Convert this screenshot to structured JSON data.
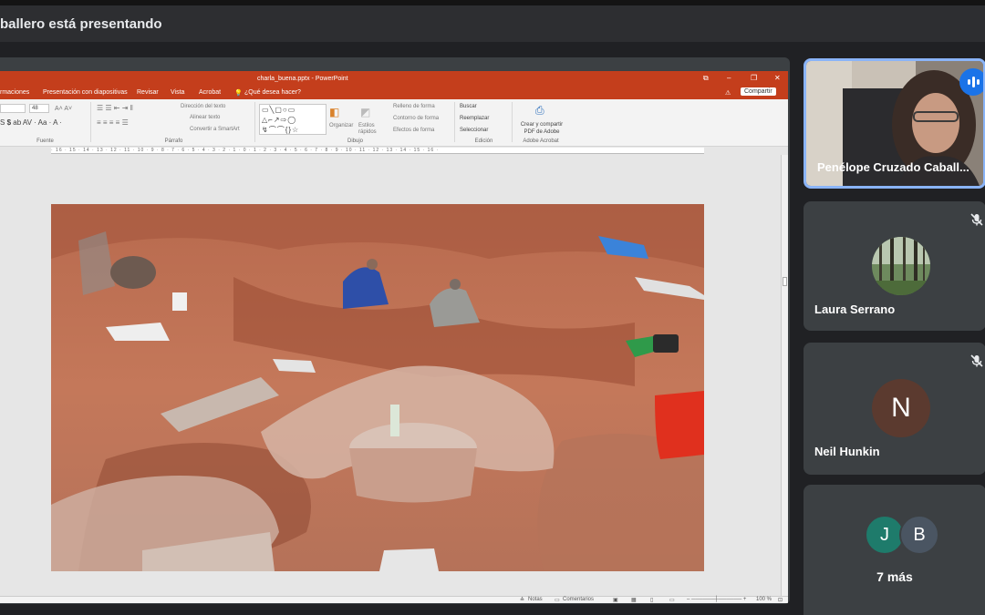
{
  "meet": {
    "presenting_banner": "ballero está presentando"
  },
  "powerpoint": {
    "window_title": "charla_buena.pptx - PowerPoint",
    "window_controls": [
      "⧉",
      "–",
      "❐",
      "✕"
    ],
    "menu": {
      "items": [
        "rmaciones",
        "Presentación con diapositivas",
        "Revisar",
        "Vista",
        "Acrobat"
      ],
      "tell_me": "¿Qué desea hacer?",
      "share": "Compartir"
    },
    "ribbon": {
      "font_size": "48",
      "groups": {
        "font": "Fuente",
        "paragraph": "Párrafo",
        "drawing": "Dibujo",
        "editing": "Edición",
        "acrobat": "Adobe Acrobat"
      },
      "paragraph_items": [
        "Dirección del texto",
        "Alinear texto",
        "Convertir a SmartArt"
      ],
      "drawing_items": {
        "organize": "Organizar",
        "quick_styles": "Estilos rápidos",
        "shape_fill": "Relleno de forma",
        "shape_outline": "Contorno de forma",
        "shape_effects": "Efectos de forma"
      },
      "editing_items": [
        "Buscar",
        "Reemplazar",
        "Seleccionar"
      ],
      "acrobat_button": "Crear y compartir PDF de Adobe"
    },
    "ruler_text": "· 16 · 15 · 14 · 13 · 12 · 11 · 10 · 9 · 8 · 7 · 6 · 5 · 4 · 3 · 2 · 1 · 0 · 1 · 2 · 3 · 4 · 5 · 6 · 7 · 8 · 9 · 10 · 11 · 12 · 13 · 14 · 15 · 16 ·",
    "status": {
      "notes": "Notas",
      "comments": "Comentarios",
      "zoom": "100 %"
    }
  },
  "participants": [
    {
      "name": "Penélope Cruzado Caball...",
      "speaking": true
    },
    {
      "name": "Laura Serrano",
      "muted": true
    },
    {
      "name": "Neil Hunkin",
      "initial": "N",
      "muted": true
    }
  ],
  "more": {
    "avatars": [
      "J",
      "B"
    ],
    "label": "7 más"
  },
  "colors": {
    "meet_bg": "#202124",
    "tile_bg": "#3c4043",
    "ppt_accent": "#c43e1c",
    "speaking_blue": "#1a73e8",
    "avatar_n": "#5b3a2f",
    "avatar_j": "#1e7b6b",
    "avatar_b": "#4a5562"
  }
}
